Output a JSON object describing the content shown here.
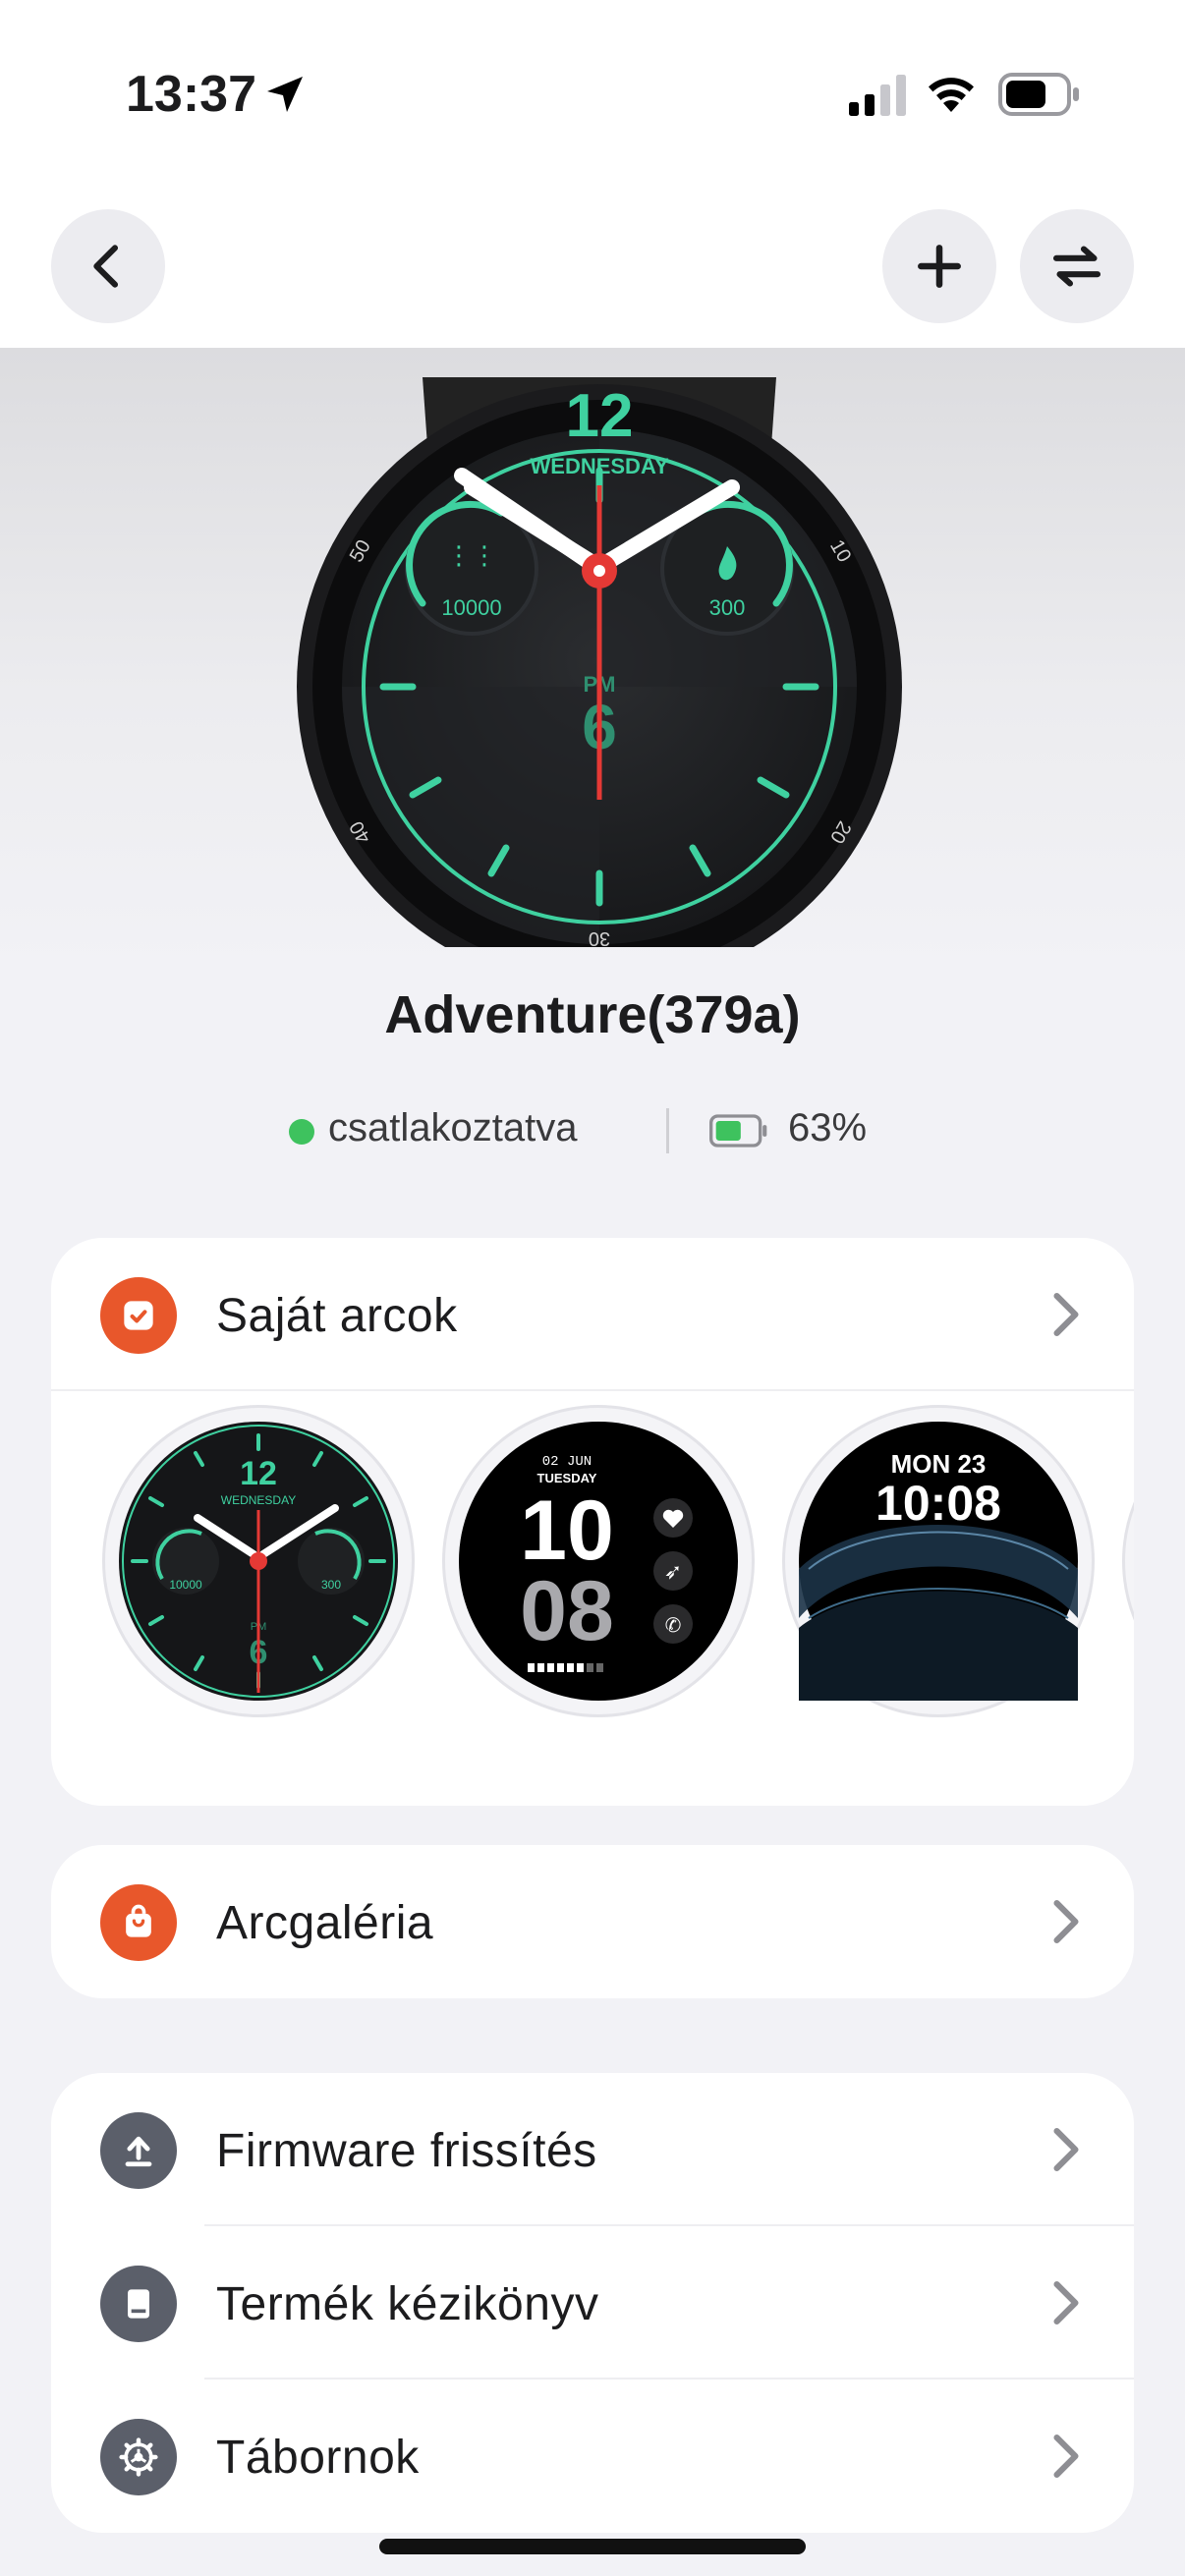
{
  "status_bar": {
    "time": "13:37",
    "icons": [
      "location-arrow-icon",
      "signal-icon",
      "wifi-icon",
      "battery-icon"
    ]
  },
  "nav": {
    "back_icon": "chevron-left-icon",
    "add_icon": "plus-icon",
    "switch_icon": "swap-arrows-icon"
  },
  "hero_watch": {
    "date_number": "12",
    "weekday": "WEDNESDAY",
    "steps": "10000",
    "calories": "300",
    "ampm": "PM",
    "bottom_number": "6",
    "bezel_numbers": [
      "10",
      "20",
      "30",
      "40",
      "50"
    ]
  },
  "device": {
    "name": "Adventure(379a)",
    "connection_status": "csatlakoztatva",
    "battery_percent": "63%",
    "battery_level": 0.63
  },
  "my_faces": {
    "label": "Saját arcok",
    "icon": "watch-face-icon",
    "faces": [
      {
        "date": "12",
        "weekday": "WEDNESDAY",
        "steps": "10000",
        "calories": "300",
        "ampm": "PM",
        "six": "6"
      },
      {
        "date": "02 JUN",
        "weekday": "TUESDAY",
        "hour": "10",
        "minute": "08"
      },
      {
        "date": "MON 23",
        "time": "10:08"
      }
    ]
  },
  "gallery": {
    "label": "Arcgaléria",
    "icon": "shopping-bag-icon"
  },
  "settings": [
    {
      "label": "Firmware frissítés",
      "icon": "upload-icon"
    },
    {
      "label": "Termék kézikönyv",
      "icon": "book-icon"
    },
    {
      "label": "Tábornok",
      "icon": "gear-icon"
    }
  ],
  "colors": {
    "accent_orange": "#e8572b",
    "accent_green": "#3fd1a0",
    "hand_red": "#e53935",
    "connected_green": "#3ec25e",
    "icon_gray": "#5b5f6a"
  }
}
